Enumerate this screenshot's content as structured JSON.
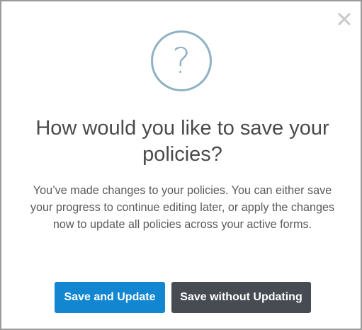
{
  "dialog": {
    "icon": "question-mark-icon",
    "icon_glyph": "?",
    "close_icon": "close-icon",
    "title": "How would you like to save your policies?",
    "message": "You’ve made changes to your policies. You can either save your progress to continue editing later, or apply the changes now to update all policies across your active forms.",
    "primary_button_label": "Save and Update",
    "secondary_button_label": "Save without Updating"
  },
  "colors": {
    "primary": "#1286d1",
    "secondary": "#474c53",
    "icon": "#8fb1c4",
    "close": "#c7c7c7",
    "border": "#9a9a9a"
  }
}
